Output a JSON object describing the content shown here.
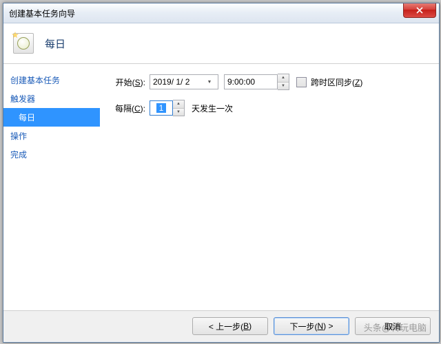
{
  "window": {
    "title": "创建基本任务向导"
  },
  "header": {
    "title": "每日"
  },
  "sidebar": {
    "items": [
      {
        "label": "创建基本任务",
        "sub": false,
        "selected": false
      },
      {
        "label": "触发器",
        "sub": false,
        "selected": false
      },
      {
        "label": "每日",
        "sub": true,
        "selected": true
      },
      {
        "label": "操作",
        "sub": false,
        "selected": false
      },
      {
        "label": "完成",
        "sub": false,
        "selected": false
      }
    ]
  },
  "form": {
    "start_label_pre": "开始(",
    "start_key": "S",
    "start_label_post": "):",
    "date_value": "2019/ 1/ 2",
    "time_value": "9:00:00",
    "sync_label_pre": "跨时区同步(",
    "sync_key": "Z",
    "sync_label_post": ")",
    "interval_label_pre": "每隔(",
    "interval_key": "C",
    "interval_label_post": "):",
    "interval_value": "1",
    "interval_suffix": "天发生一次"
  },
  "footer": {
    "back_pre": "< 上一步(",
    "back_key": "B",
    "back_post": ")",
    "next_pre": "下一步(",
    "next_key": "N",
    "next_post": ") >",
    "cancel": "取消"
  },
  "watermark": "头条@转玩电脑"
}
